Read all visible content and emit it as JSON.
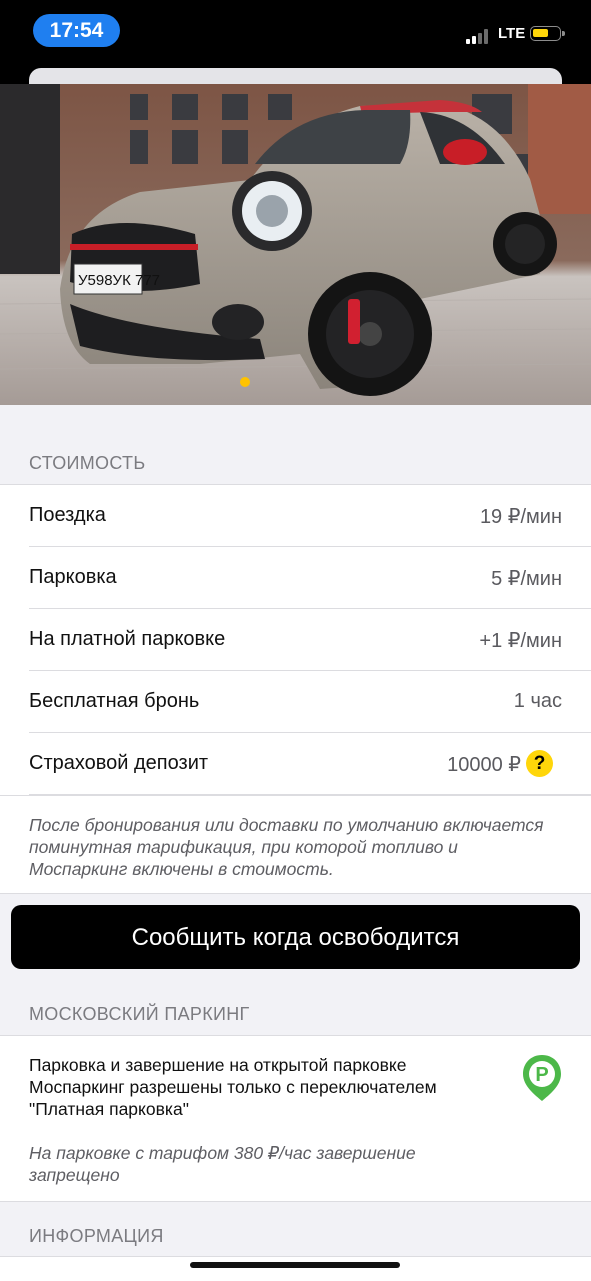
{
  "status_bar": {
    "time": "17:54",
    "network": "LTE",
    "battery_level": 0.45,
    "signal_bars_active": 2
  },
  "car": {
    "plate_text": "У598УК 777",
    "image_count": 1,
    "active_image_index": 0
  },
  "pricing": {
    "header": "СТОИМОСТЬ",
    "rows": [
      {
        "label": "Поездка",
        "value": "19 ₽/мин"
      },
      {
        "label": "Парковка",
        "value": "5 ₽/мин"
      },
      {
        "label": "На платной парковке",
        "value": "+1 ₽/мин"
      },
      {
        "label": "Бесплатная бронь",
        "value": "1 час"
      },
      {
        "label": "Страховой депозит",
        "value": "10000 ₽"
      }
    ],
    "help_label": "?",
    "note": "После бронирования или доставки по умолчанию включается поминутная тарификация, при которой топливо и Моспаркинг включены в стоимость."
  },
  "notify_button_label": "Сообщить когда освободится",
  "parking": {
    "header": "МОСКОВСКИЙ ПАРКИНГ",
    "text": "Парковка и завершение на открытой парковке Моспаркинг разрешены только с переключателем \"Платная парковка\"",
    "note": "На парковке с тарифом 380 ₽/час завершение запрещено",
    "icon_label": "P"
  },
  "info": {
    "header": "ИНФОРМАЦИЯ"
  },
  "colors": {
    "accent_yellow": "#ffd60a",
    "time_pill": "#1f7ff0",
    "parking_green": "#4cb849",
    "button_black": "#000000"
  }
}
